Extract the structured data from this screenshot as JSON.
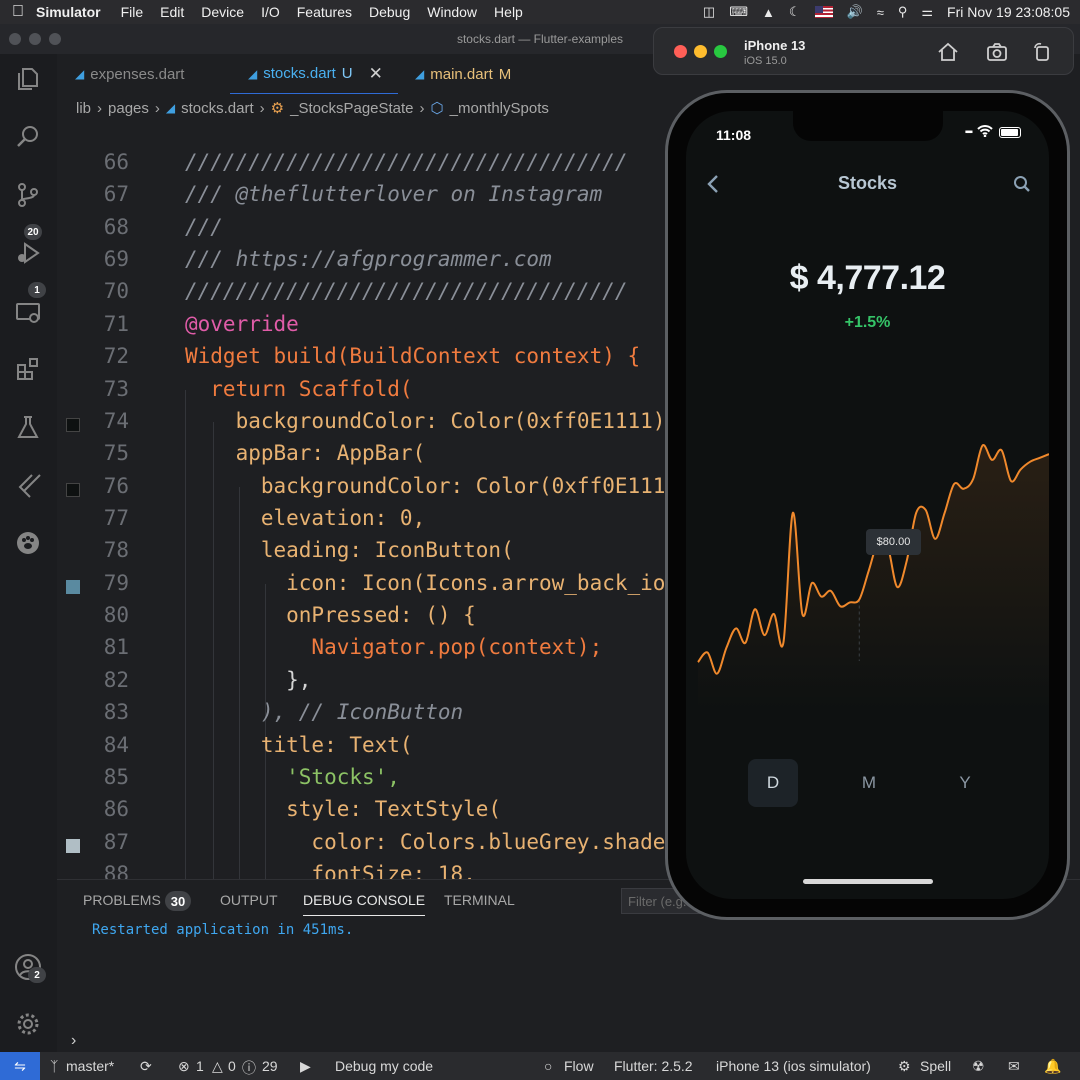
{
  "menubar": {
    "app_name": "Simulator",
    "items": [
      "File",
      "Edit",
      "Device",
      "I/O",
      "Features",
      "Debug",
      "Window",
      "Help"
    ],
    "datetime": "Fri Nov 19  23:08:05"
  },
  "window": {
    "title": "stocks.dart — Flutter-examples"
  },
  "activity": {
    "source_control_badge": "20",
    "debug_badge": "1",
    "accounts_badge": "2"
  },
  "tabs": [
    {
      "label": "expenses.dart",
      "status": ""
    },
    {
      "label": "stocks.dart",
      "status": "U"
    },
    {
      "label": "main.dart",
      "status": "M"
    }
  ],
  "breadcrumb": [
    "lib",
    "pages",
    "stocks.dart",
    "_StocksPageState",
    "_monthlySpots"
  ],
  "code_lines": [
    {
      "n": "66",
      "text": "///////////////////////////////////"
    },
    {
      "n": "67",
      "text": "/// @theflutterlover on Instagram"
    },
    {
      "n": "68",
      "text": "///"
    },
    {
      "n": "69",
      "text": "/// https://afgprogrammer.com"
    },
    {
      "n": "70",
      "text": "///////////////////////////////////"
    },
    {
      "n": "71",
      "text": "@override"
    },
    {
      "n": "72",
      "text": "Widget build(BuildContext context) {"
    },
    {
      "n": "73",
      "text": "  return Scaffold("
    },
    {
      "n": "74",
      "text": "    backgroundColor: Color(0xff0E1111),"
    },
    {
      "n": "75",
      "text": "    appBar: AppBar("
    },
    {
      "n": "76",
      "text": "      backgroundColor: Color(0xff0E1111),"
    },
    {
      "n": "77",
      "text": "      elevation: 0,"
    },
    {
      "n": "78",
      "text": "      leading: IconButton("
    },
    {
      "n": "79",
      "text": "        icon: Icon(Icons.arrow_back_ios),"
    },
    {
      "n": "80",
      "text": "        onPressed: () {"
    },
    {
      "n": "81",
      "text": "          Navigator.pop(context);"
    },
    {
      "n": "82",
      "text": "        },"
    },
    {
      "n": "83",
      "text": "      ), // IconButton"
    },
    {
      "n": "84",
      "text": "      title: Text("
    },
    {
      "n": "85",
      "text": "        'Stocks',"
    },
    {
      "n": "86",
      "text": "        style: TextStyle("
    },
    {
      "n": "87",
      "text": "          color: Colors.blueGrey.shade300,"
    },
    {
      "n": "88",
      "text": "          fontSize: 18,"
    }
  ],
  "panel": {
    "tabs": [
      "PROBLEMS",
      "OUTPUT",
      "DEBUG CONSOLE",
      "TERMINAL"
    ],
    "problems_count": "30",
    "filter_placeholder": "Filter (e.g.",
    "console_output": "Restarted application in 451ms."
  },
  "statusbar": {
    "branch": "master*",
    "errors": "1",
    "warnings": "0",
    "infos": "29",
    "debug_label": "Debug my code",
    "flow": "Flow",
    "flutter_version": "Flutter: 2.5.2",
    "device": "iPhone 13 (ios simulator)",
    "spell": "Spell"
  },
  "simulator": {
    "device_name": "iPhone 13",
    "os": "iOS 15.0"
  },
  "phone": {
    "time": "11:08",
    "title": "Stocks",
    "price": "$ 4,777.12",
    "change": "+1.5%",
    "tooltip": "$80.00",
    "periods": [
      "D",
      "M",
      "Y"
    ],
    "active_period": "D"
  },
  "colors": {
    "accent": "#f0892c",
    "positive": "#35c468",
    "app_background": "#0e1111",
    "title": "#b8c7d3"
  },
  "chart_data": {
    "type": "line",
    "x": [
      0,
      1,
      2,
      3,
      4,
      5,
      6,
      7,
      8,
      9,
      10,
      11,
      12,
      13,
      14,
      15,
      16,
      17,
      18,
      19,
      20,
      21,
      22,
      23,
      24,
      25,
      26,
      27,
      28,
      29,
      30,
      31,
      32,
      33,
      34,
      35,
      36,
      37
    ],
    "series": [
      {
        "values": [
          30,
          40,
          18,
          45,
          65,
          50,
          85,
          58,
          80,
          50,
          185,
          80,
          112,
          98,
          104,
          88,
          92,
          95,
          125,
          155,
          150,
          108,
          135,
          185,
          188,
          158,
          185,
          215,
          210,
          220,
          255,
          240,
          250,
          218,
          230,
          238,
          242,
          246
        ]
      }
    ],
    "highlight_index": 17,
    "highlight_label": "$80.00",
    "ylim": [
      0,
      270
    ]
  }
}
